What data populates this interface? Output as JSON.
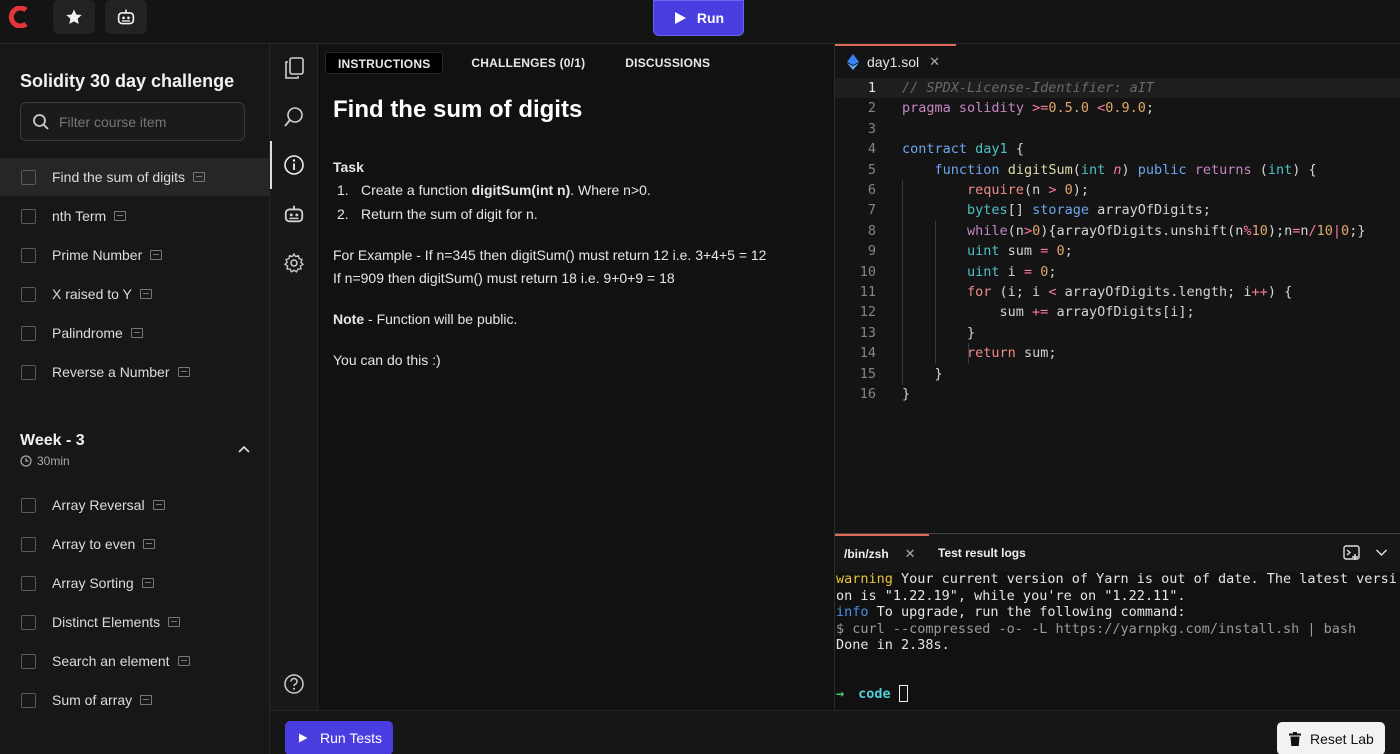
{
  "topbar": {
    "run_label": "Run"
  },
  "sidebar": {
    "course_title": "Solidity 30 day challenge",
    "search_placeholder": "Filter course item",
    "items": [
      {
        "label": "Find the sum of digits",
        "active": true
      },
      {
        "label": "nth Term"
      },
      {
        "label": "Prime Number"
      },
      {
        "label": "X raised to Y"
      },
      {
        "label": "Palindrome"
      },
      {
        "label": "Reverse a Number"
      }
    ],
    "week": {
      "title": "Week - 3",
      "duration": "30min"
    },
    "week_items": [
      {
        "label": "Array Reversal"
      },
      {
        "label": "Array to even"
      },
      {
        "label": "Array Sorting"
      },
      {
        "label": "Distinct Elements"
      },
      {
        "label": "Search an element"
      },
      {
        "label": "Sum of array"
      }
    ]
  },
  "instructions": {
    "tabs": [
      "INSTRUCTIONS",
      "CHALLENGES (0/1)",
      "DISCUSSIONS"
    ],
    "title": "Find the sum of digits",
    "task_heading": "Task",
    "step1_prefix": "Create a function ",
    "step1_bold": "digitSum(int n)",
    "step1_suffix": ". Where n>0.",
    "step2": "Return the sum of digit for n.",
    "example1": "For Example - If n=345 then digitSum() must return 12 i.e. 3+4+5 = 12",
    "example2": "If n=909 then digitSum() must return 18 i.e. 9+0+9 = 18",
    "note_bold": "Note",
    "note_rest": " - Function will be public.",
    "closing": "You can do this :)"
  },
  "editor": {
    "filename": "day1.sol",
    "line_numbers": [
      "1",
      "2",
      "3",
      "4",
      "5",
      "6",
      "7",
      "8",
      "9",
      "10",
      "11",
      "12",
      "13",
      "14",
      "15",
      "16"
    ]
  },
  "terminal": {
    "tab_shell": "/bin/zsh",
    "tab_logs": "Test result logs",
    "warn_tag": "warning",
    "warn_text": " Your current version of Yarn is out of date. The latest version is \"1.22.19\", while you're on \"1.22.11\".",
    "info_tag": "info",
    "info_text": " To upgrade, run the following command:",
    "cmd_line": "$ curl --compressed -o- -L https://yarnpkg.com/install.sh | bash",
    "done_line": "Done in 2.38s.",
    "prompt_arrow": "→",
    "prompt_dir": "code"
  },
  "bottom": {
    "run_tests_label": "Run Tests",
    "reset_label": "Reset Lab"
  },
  "colors": {
    "accent": "#4a3de0",
    "tab_highlight": "#e06a5a",
    "logo": "#e5343c"
  }
}
